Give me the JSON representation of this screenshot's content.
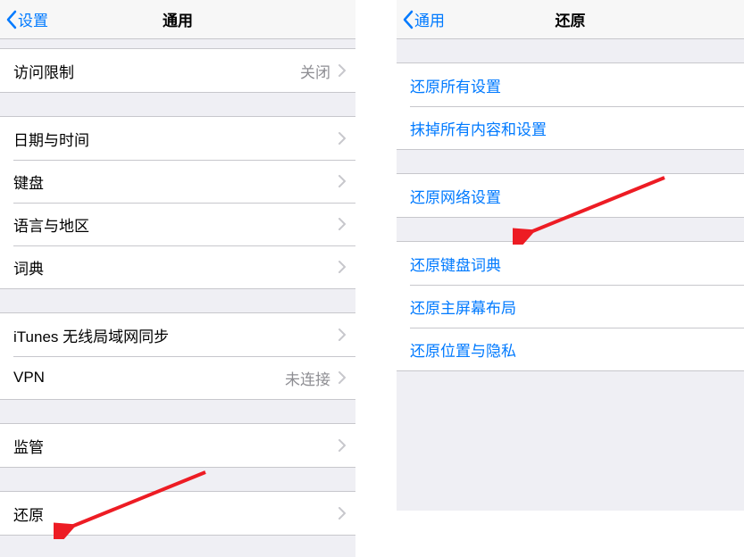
{
  "colors": {
    "ios_blue": "#007aff",
    "separator": "#c7c7cc",
    "group_bg": "#efeff4",
    "gray_value": "#8e8e93",
    "arrow_red": "#ed1c24"
  },
  "left": {
    "nav": {
      "back_label": "设置",
      "title": "通用"
    },
    "groups": [
      {
        "rows": [
          {
            "label": "访问限制",
            "value": "关闭"
          }
        ]
      },
      {
        "rows": [
          {
            "label": "日期与时间"
          },
          {
            "label": "键盘"
          },
          {
            "label": "语言与地区"
          },
          {
            "label": "词典"
          }
        ]
      },
      {
        "rows": [
          {
            "label": "iTunes 无线局域网同步"
          },
          {
            "label": "VPN",
            "value": "未连接"
          }
        ]
      },
      {
        "rows": [
          {
            "label": "监管"
          }
        ]
      },
      {
        "rows": [
          {
            "label": "还原"
          }
        ]
      }
    ]
  },
  "right": {
    "nav": {
      "back_label": "通用",
      "title": "还原"
    },
    "groups": [
      {
        "rows": [
          {
            "label": "还原所有设置"
          },
          {
            "label": "抹掉所有内容和设置"
          }
        ]
      },
      {
        "rows": [
          {
            "label": "还原网络设置"
          }
        ]
      },
      {
        "rows": [
          {
            "label": "还原键盘词典"
          },
          {
            "label": "还原主屏幕布局"
          },
          {
            "label": "还原位置与隐私"
          }
        ]
      }
    ]
  }
}
